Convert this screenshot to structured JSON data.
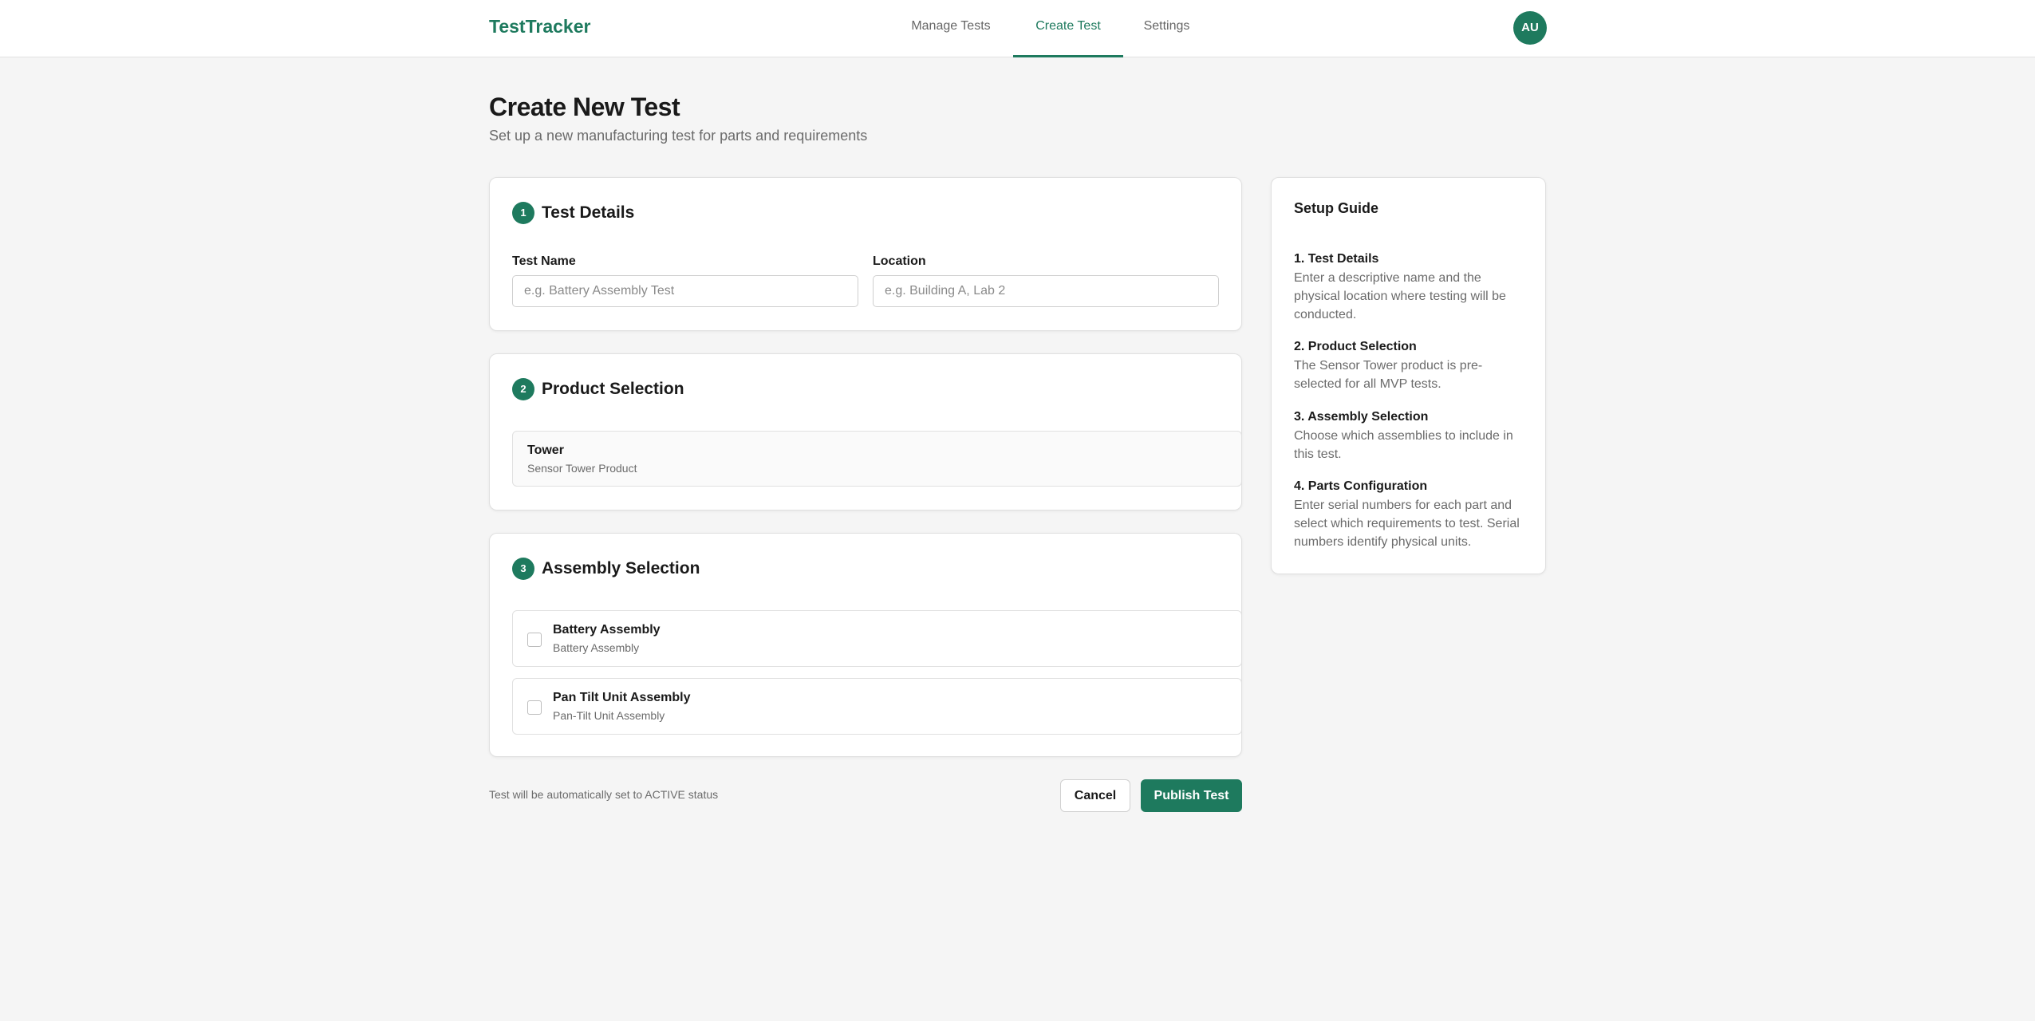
{
  "app": {
    "brand": "TestTracker"
  },
  "nav": {
    "tabs": [
      {
        "label": "Manage Tests"
      },
      {
        "label": "Create Test"
      },
      {
        "label": "Settings"
      }
    ],
    "avatar": "AU"
  },
  "page": {
    "title": "Create New Test",
    "subtitle": "Set up a new manufacturing test for parts and requirements"
  },
  "test_details": {
    "step": "1",
    "title": "Test Details",
    "name_label": "Test Name",
    "name_placeholder": "e.g. Battery Assembly Test",
    "name_value": "",
    "location_label": "Location",
    "location_placeholder": "e.g. Building A, Lab 2",
    "location_value": ""
  },
  "product_selection": {
    "step": "2",
    "title": "Product Selection",
    "product_name": "Tower",
    "product_desc": "Sensor Tower Product"
  },
  "assembly_selection": {
    "step": "3",
    "title": "Assembly Selection",
    "items": [
      {
        "name": "Battery Assembly",
        "desc": "Battery Assembly",
        "checked": false
      },
      {
        "name": "Pan Tilt Unit Assembly",
        "desc": "Pan-Tilt Unit Assembly",
        "checked": false
      }
    ]
  },
  "footer": {
    "note": "Test will be automatically set to ACTIVE status",
    "cancel_label": "Cancel",
    "publish_label": "Publish Test"
  },
  "guide": {
    "title": "Setup Guide",
    "steps": [
      {
        "title": "1. Test Details",
        "desc": "Enter a descriptive name and the physical location where testing will be conducted."
      },
      {
        "title": "2. Product Selection",
        "desc": "The Sensor Tower product is pre-selected for all MVP tests."
      },
      {
        "title": "3. Assembly Selection",
        "desc": "Choose which assemblies to include in this test."
      },
      {
        "title": "4. Parts Configuration",
        "desc": "Enter serial numbers for each part and select which requirements to test. Serial numbers identify physical units."
      }
    ]
  },
  "colors": {
    "accent": "#1e7a5e",
    "background": "#f5f5f5",
    "muted_text": "#6b6b6b"
  }
}
